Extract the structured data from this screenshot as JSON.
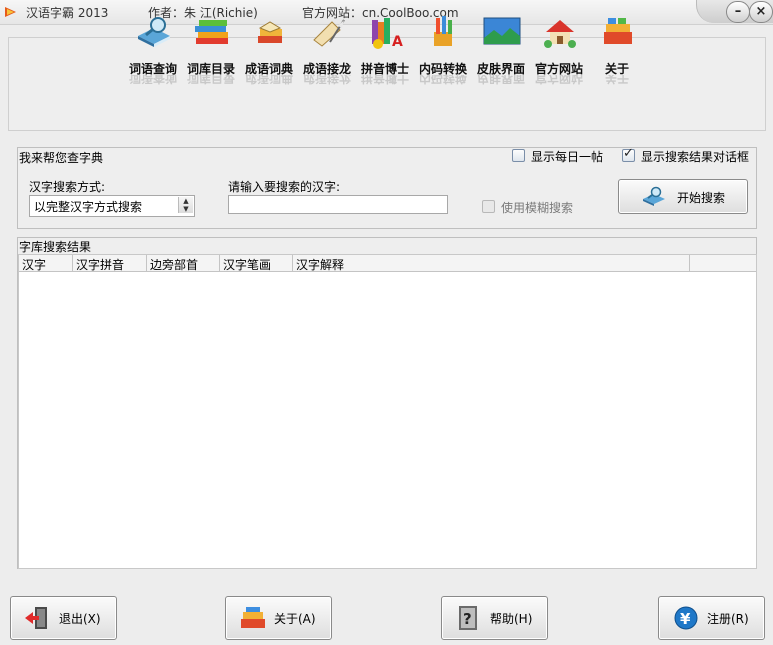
{
  "window": {
    "app_title": "汉语字霸 2013",
    "author_label": "作者：朱 江(Richie)",
    "website_label": "官方网站：cn.CoolBoo.com",
    "minimize_glyph": "–",
    "close_glyph": "×"
  },
  "toolbar": {
    "items": [
      {
        "label": "词语查询",
        "icon": "book-magnifier-icon"
      },
      {
        "label": "词库目录",
        "icon": "stacked-books-icon"
      },
      {
        "label": "成语词典",
        "icon": "open-books-icon"
      },
      {
        "label": "成语接龙",
        "icon": "scroll-quill-icon"
      },
      {
        "label": "拼音博士",
        "icon": "books-letter-a-icon"
      },
      {
        "label": "内码转换",
        "icon": "pencils-cup-icon"
      },
      {
        "label": "皮肤界面",
        "icon": "landscape-skin-icon"
      },
      {
        "label": "官方网站",
        "icon": "house-icon"
      },
      {
        "label": "关于",
        "icon": "color-books-icon"
      }
    ]
  },
  "lookup": {
    "group_title": "我来帮您查字典",
    "daily_checkbox_label": "显示每日一帖",
    "daily_checked": false,
    "dialog_checkbox_label": "显示搜索结果对话框",
    "dialog_checked": true,
    "mode_label": "汉字搜索方式:",
    "mode_value": "以完整汉字方式搜索",
    "input_label": "请输入要搜索的汉字:",
    "input_value": "",
    "fuzzy_label": "使用模糊搜索",
    "fuzzy_checked": false,
    "search_button": "开始搜索"
  },
  "results": {
    "group_title": "字库搜索结果",
    "columns": [
      "汉字",
      "汉字拼音",
      "边旁部首",
      "汉字笔画",
      "汉字解释"
    ],
    "rows": []
  },
  "footer": {
    "exit_button": "退出(X)",
    "about_button": "关于(A)",
    "help_button": "帮助(H)",
    "register_button": "注册(R)"
  }
}
